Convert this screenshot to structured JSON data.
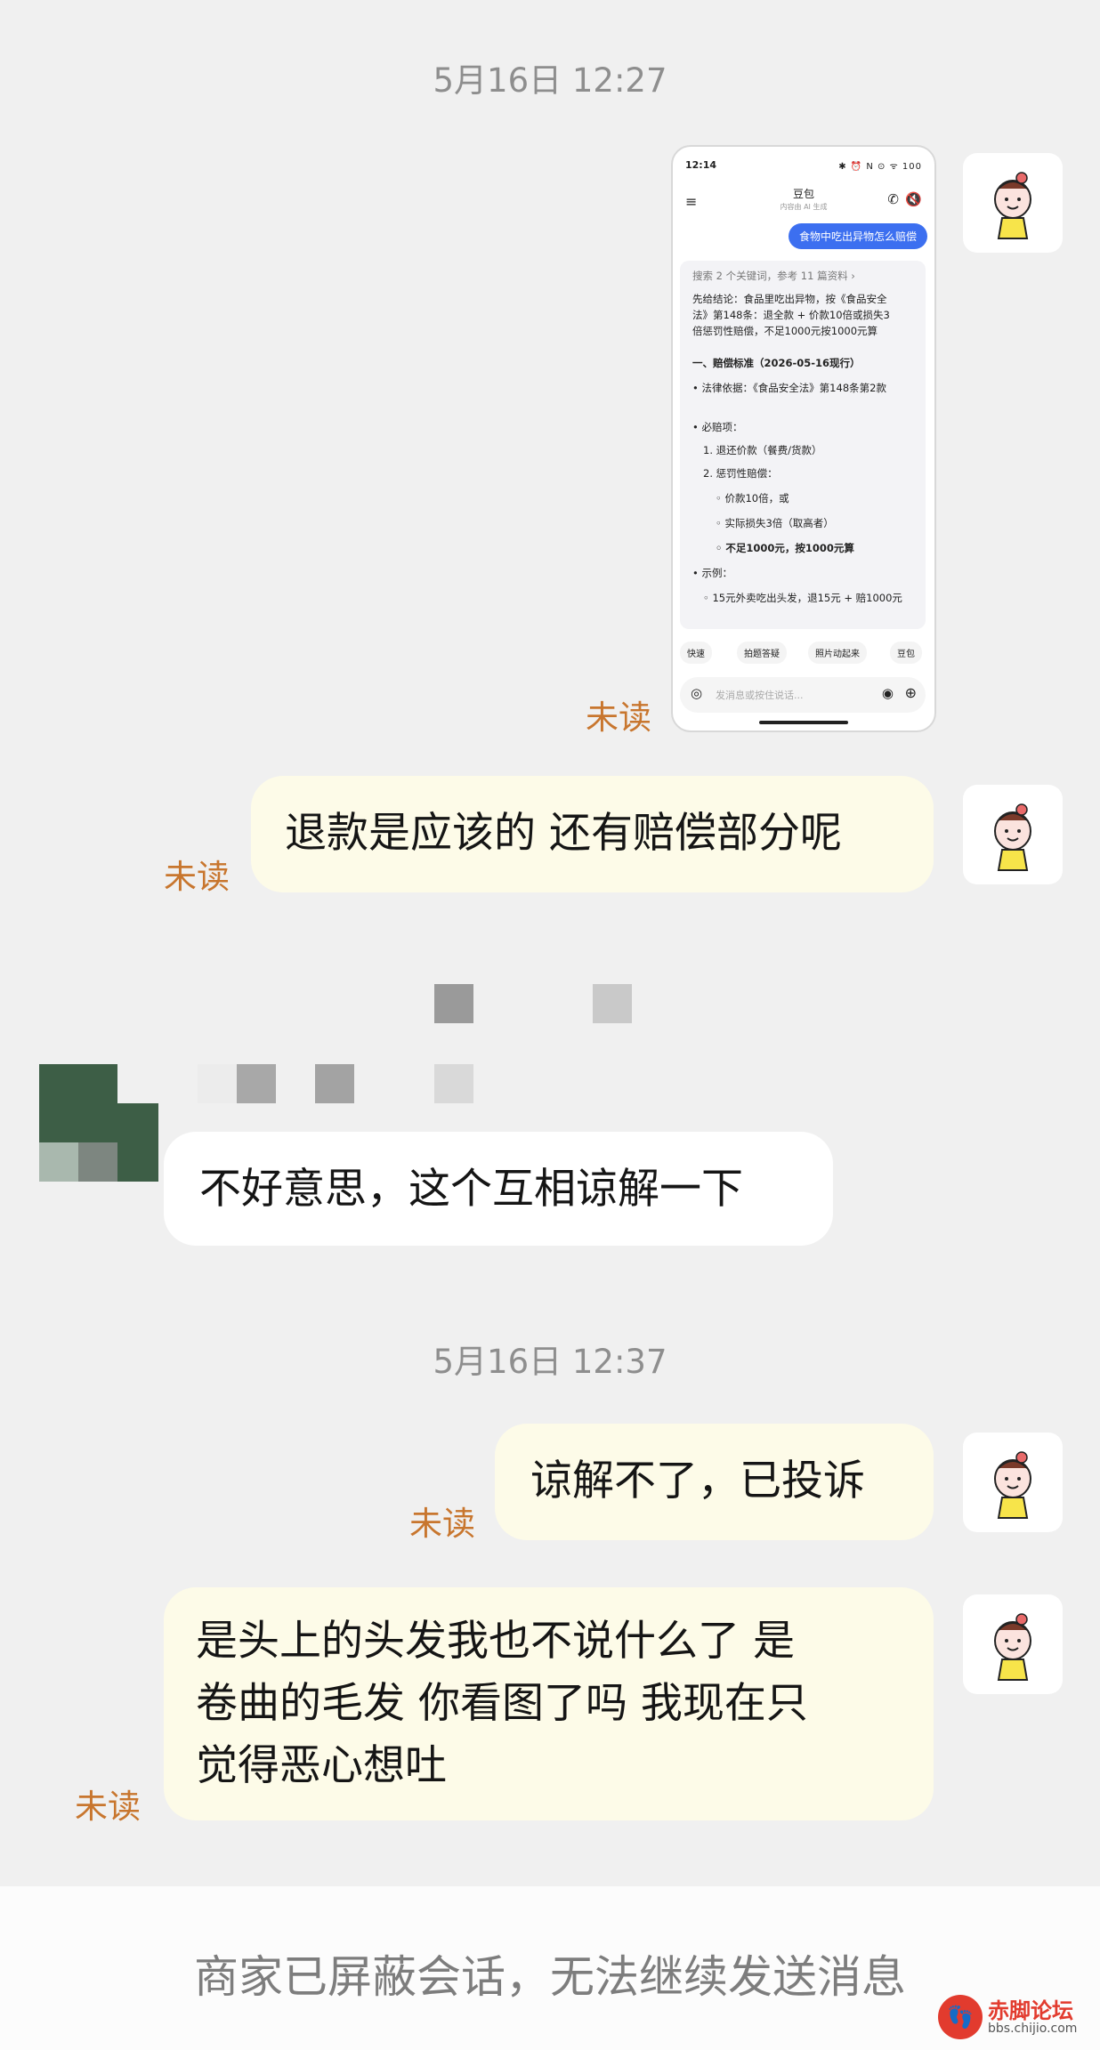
{
  "messages": {
    "timestamp1": "5月16日 12:27",
    "timestamp2": "5月16日 12:37",
    "unread_label": "未读",
    "msg_refund": "退款是应该的 还有赔偿部分呢",
    "msg_sorry": "不好意思，这个互相谅解一下",
    "msg_complaint": "谅解不了，已投诉",
    "msg_hair_line1": "是头上的头发我也不说什么了  是",
    "msg_hair_line2": "卷曲的毛发  你看图了吗  我现在只",
    "msg_hair_line3": "觉得恶心想吐"
  },
  "screenshot": {
    "time": "12:14",
    "status_icons": "✱ ⏰ N ⊙ ᯤ 100",
    "app_title": "豆包",
    "app_subtitle": "内容由 AI 生成",
    "question": "食物中吃出异物怎么赔偿",
    "search_info": "搜索 2 个关键词，参考 11 篇资料  ›",
    "lines": [
      "先给结论：食品里吃出异物，按《食品安全",
      "法》第148条：退全款 + 价款10倍或损失3",
      "倍惩罚性赔偿，不足1000元按1000元算",
      "一、赔偿标准（2026-05-16现行）",
      "• 法律依据：《食品安全法》第148条第2款",
      "• 必赔项：",
      "1. 退还价款（餐费/货款）",
      "2. 惩罚性赔偿：",
      "◦ 价款10倍，或",
      "◦ 实际损失3倍（取高者）",
      "◦ 不足1000元，按1000元算",
      "• 示例：",
      "◦ 15元外卖吃出头发，退15元 + 赔1000元"
    ],
    "chips": [
      "快速",
      "拍题答疑",
      "照片动起来",
      "豆包"
    ],
    "input_placeholder": "发消息或按住说话..."
  },
  "footer": {
    "blocked_notice": "商家已屏蔽会话，无法继续发送消息"
  },
  "watermark": {
    "name": "赤脚论坛",
    "url": "bbs.chijio.com"
  }
}
